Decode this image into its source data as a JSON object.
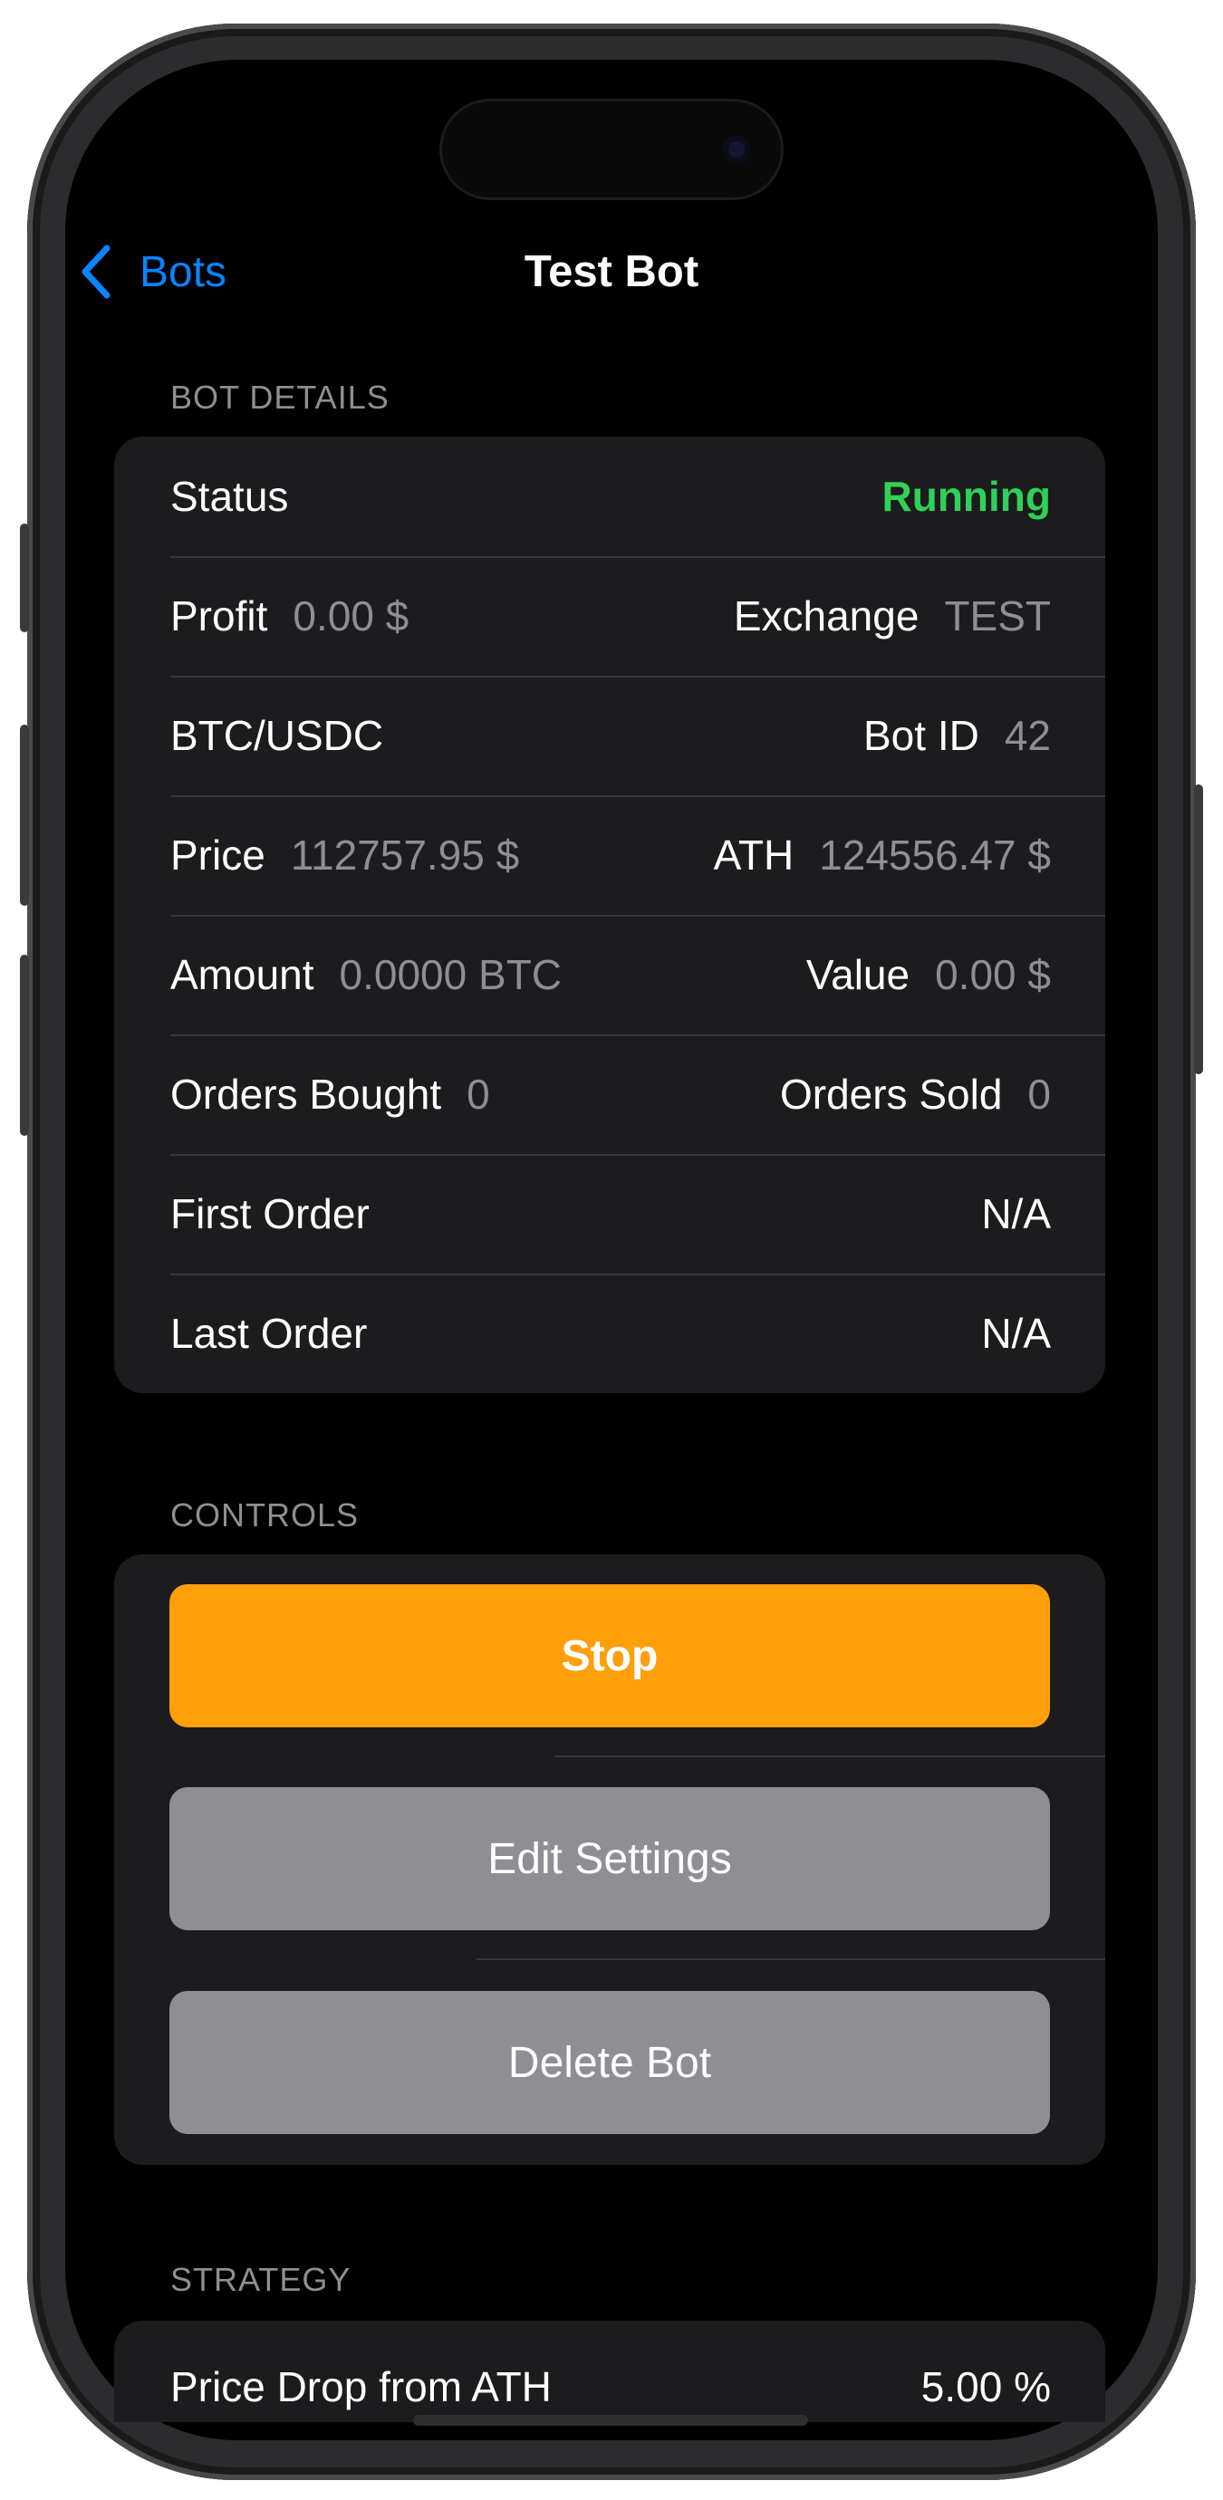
{
  "nav": {
    "back_label": "Bots",
    "title": "Test Bot"
  },
  "bot_details": {
    "header": "BOT DETAILS",
    "status": {
      "label": "Status",
      "value": "Running",
      "color": "#30d158"
    },
    "profit": {
      "label": "Profit",
      "value": "0.00 $"
    },
    "exchange": {
      "label": "Exchange",
      "value": "TEST"
    },
    "pair": {
      "label": "BTC/USDC"
    },
    "bot_id": {
      "label": "Bot ID",
      "value": "42"
    },
    "price": {
      "label": "Price",
      "value": "112757.95 $"
    },
    "ath": {
      "label": "ATH",
      "value": "124556.47 $"
    },
    "amount": {
      "label": "Amount",
      "value": "0.0000 BTC"
    },
    "value": {
      "label": "Value",
      "value": "0.00 $"
    },
    "orders_bought": {
      "label": "Orders Bought",
      "value": "0"
    },
    "orders_sold": {
      "label": "Orders Sold",
      "value": "0"
    },
    "first_order": {
      "label": "First Order",
      "value": "N/A"
    },
    "last_order": {
      "label": "Last Order",
      "value": "N/A"
    }
  },
  "controls": {
    "header": "CONTROLS",
    "stop_label": "Stop",
    "edit_label": "Edit Settings",
    "delete_label": "Delete Bot",
    "stop_color": "#ff9f0a"
  },
  "strategy": {
    "header": "STRATEGY",
    "price_drop": {
      "label": "Price Drop from ATH",
      "value": "5.00 %"
    }
  },
  "icons": {
    "back": "chevron-left-icon"
  },
  "colors": {
    "accent": "#0a84ff",
    "background": "#000000",
    "card": "#1c1c1e"
  }
}
